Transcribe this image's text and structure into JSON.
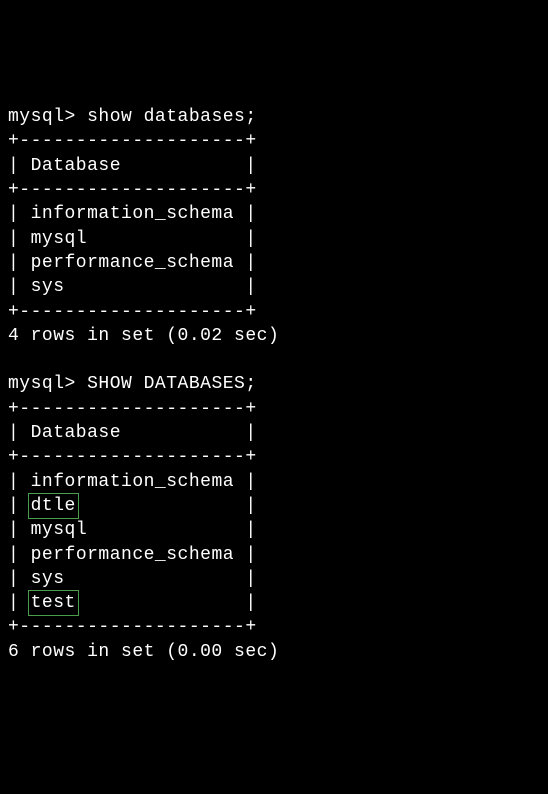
{
  "query1": {
    "prompt": "mysql>",
    "command": "show databases;",
    "border_top": "+--------------------+",
    "header": "| Database           |",
    "border_mid": "+--------------------+",
    "rows": [
      "| information_schema |",
      "| mysql              |",
      "| performance_schema |",
      "| sys                |"
    ],
    "border_bottom": "+--------------------+",
    "result": "4 rows in set (0.02 sec)"
  },
  "query2": {
    "prompt": "mysql>",
    "command": "SHOW DATABASES;",
    "border_top": "+--------------------+",
    "header": "| Database           |",
    "border_mid": "+--------------------+",
    "rows": [
      {
        "prefix": "| ",
        "value": "information_schema",
        "suffix": " |",
        "highlight": false
      },
      {
        "prefix": "| ",
        "value": "dtle",
        "suffix": "               |",
        "highlight": true
      },
      {
        "prefix": "| ",
        "value": "mysql",
        "suffix": "              |",
        "highlight": false
      },
      {
        "prefix": "| ",
        "value": "performance_schema",
        "suffix": " |",
        "highlight": false
      },
      {
        "prefix": "| ",
        "value": "sys",
        "suffix": "                |",
        "highlight": false
      },
      {
        "prefix": "| ",
        "value": "test",
        "suffix": "               |",
        "highlight": true
      }
    ],
    "border_bottom": "+--------------------+",
    "result": "6 rows in set (0.00 sec)"
  }
}
